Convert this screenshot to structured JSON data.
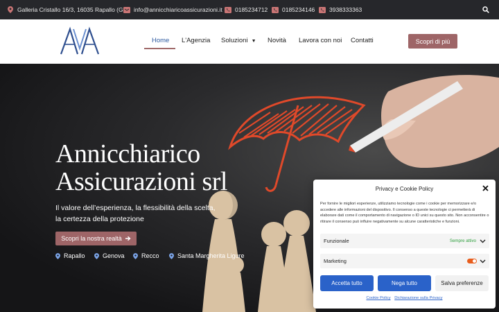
{
  "topbar": {
    "address": "Galleria Cristallo 16/3, 16035 Rapallo (GE)",
    "email": "info@annicchiaricoassicurazioni.it",
    "phone1": "0185234712",
    "phone2": "0185234146",
    "phone3": "3938333363"
  },
  "nav": {
    "items": [
      "Home",
      "L'Agenzia",
      "Soluzioni",
      "Novità",
      "Lavora con noi",
      "Contatti"
    ],
    "cta": "Scopri di più"
  },
  "hero": {
    "title_line1": "Annicchiarico",
    "title_line2": "Assicurazioni srl",
    "subtitle_line1": "Il valore dell’esperienza, la flessibilità della scelta,",
    "subtitle_line2": "la certezza della protezione",
    "button": "Scopri la nostra realtà",
    "locations": [
      "Rapallo",
      "Genova",
      "Recco",
      "Santa Margherita Ligure"
    ]
  },
  "cookie": {
    "title": "Privacy e Cookie Policy",
    "text": "Per fornire le migliori esperienze, utilizziamo tecnologie come i cookie per memorizzare e/o accedere alle informazioni del dispositivo. Il consenso a queste tecnologie ci permetterà di elaborare dati come il comportamento di navigazione o ID unici su questo sito. Non acconsentire o ritirare il consenso può influire negativamente su alcune caratteristiche e funzioni.",
    "functional_label": "Funzionale",
    "functional_status": "Sempre attivo",
    "marketing_label": "Marketing",
    "accept": "Accetta tutto",
    "deny": "Nega tutto",
    "save": "Salva preferenze",
    "link1": "Cookie Policy",
    "link2": "Dichiarazione sulla Privacy"
  },
  "colors": {
    "topbar_bg": "#26272b",
    "accent": "#9e6567",
    "nav_active": "#2d5aa0",
    "cookie_primary": "#2a62c9",
    "umbrella": "#e0492a"
  },
  "icons": [
    "map-pin-icon",
    "email-icon",
    "phone-icon",
    "search-icon",
    "caret-down-icon",
    "arrow-right-icon",
    "close-icon",
    "chevron-down-icon"
  ]
}
